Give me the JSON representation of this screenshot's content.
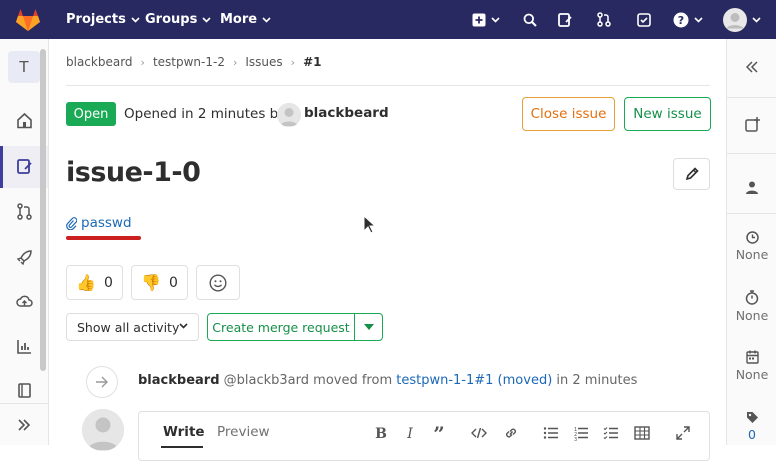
{
  "navbar": {
    "projects_label": "Projects",
    "groups_label": "Groups",
    "more_label": "More"
  },
  "sidebar": {
    "project_initial": "T"
  },
  "breadcrumb": {
    "items": [
      "blackbeard",
      "testpwn-1-2",
      "Issues"
    ],
    "current": "#1"
  },
  "issue": {
    "status": "Open",
    "opened_text": "Opened in 2 minutes by",
    "author": "blackbeard",
    "title": "issue-1-0",
    "attachment": "passwd",
    "close_button": "Close issue",
    "new_button": "New issue"
  },
  "awards": {
    "thumbs_up_count": "0",
    "thumbs_down_count": "0"
  },
  "activity": {
    "filter_label": "Show all activity",
    "merge_request_label": "Create merge request"
  },
  "system_note": {
    "author": "blackbeard",
    "handle": "@blackb3ard",
    "text_before": "moved from",
    "link": "testpwn-1-1#1 (moved)",
    "text_after": "in 2 minutes"
  },
  "editor": {
    "write_tab": "Write",
    "preview_tab": "Preview"
  },
  "right_sidebar": {
    "milestone_value": "None",
    "time_value": "None",
    "due_value": "None",
    "labels_count": "0"
  },
  "colors": {
    "navbar": "#292961",
    "open_badge": "#1aaa55",
    "close_issue": "#e36f0d",
    "link": "#1b69b6",
    "annotation_underline": "#cc1f1f"
  }
}
